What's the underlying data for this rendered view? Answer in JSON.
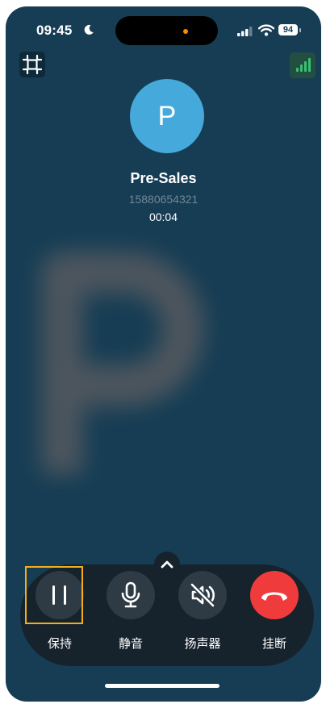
{
  "status_bar": {
    "time": "09:45",
    "battery": "94"
  },
  "caller": {
    "initial": "P",
    "name": "Pre-Sales",
    "number": "15880654321",
    "duration": "00:04"
  },
  "controls": [
    {
      "label": "保持",
      "icon": "pause-icon",
      "selected": true
    },
    {
      "label": "静音",
      "icon": "microphone-icon"
    },
    {
      "label": "扬声器",
      "icon": "speaker-muted-icon"
    },
    {
      "label": "挂断",
      "icon": "hang-up-icon"
    }
  ],
  "colors": {
    "background": "#163d54",
    "avatar": "#45a9db",
    "hangup": "#ef3b3b",
    "highlight": "#f2ae1c",
    "signal_good": "#38c172"
  }
}
